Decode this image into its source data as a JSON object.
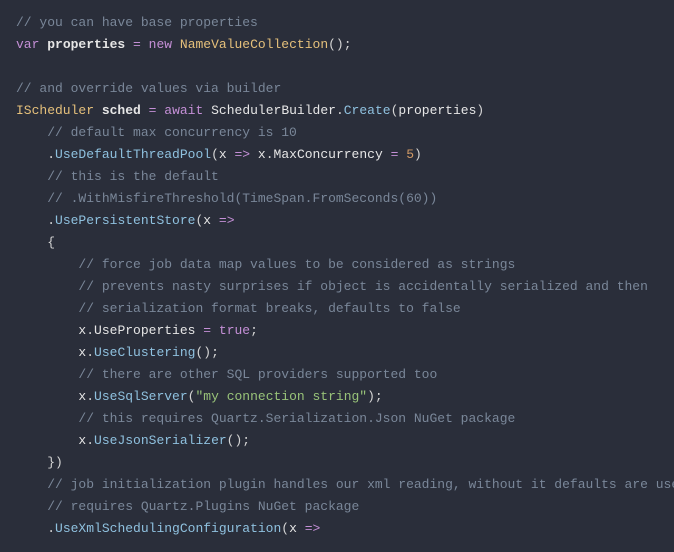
{
  "code": {
    "c1": "// you can have base properties",
    "kw_var": "var",
    "properties": "properties",
    "kw_new": "new",
    "NameValueCollection": "NameValueCollection",
    "c2": "// and override values via builder",
    "IScheduler": "IScheduler",
    "sched": "sched",
    "kw_await": "await",
    "SchedulerBuilder": "SchedulerBuilder",
    "Create": "Create",
    "c3": "// default max concurrency is 10",
    "UseDefaultThreadPool": "UseDefaultThreadPool",
    "x": "x",
    "arrow": "=>",
    "MaxConcurrency": "MaxConcurrency",
    "five": "5",
    "c4": "// this is the default",
    "c5": "// .WithMisfireThreshold(TimeSpan.FromSeconds(60))",
    "UsePersistentStore": "UsePersistentStore",
    "c6": "// force job data map values to be considered as strings",
    "c7": "// prevents nasty surprises if object is accidentally serialized and then",
    "c8": "// serialization format breaks, defaults to false",
    "UseProperties": "UseProperties",
    "true": "true",
    "UseClustering": "UseClustering",
    "c9": "// there are other SQL providers supported too",
    "UseSqlServer": "UseSqlServer",
    "connstr": "\"my connection string\"",
    "c10": "// this requires Quartz.Serialization.Json NuGet package",
    "UseJsonSerializer": "UseJsonSerializer",
    "c11": "// job initialization plugin handles our xml reading, without it defaults are used",
    "c12": "// requires Quartz.Plugins NuGet package",
    "UseXmlSchedulingConfiguration": "UseXmlSchedulingConfiguration"
  }
}
